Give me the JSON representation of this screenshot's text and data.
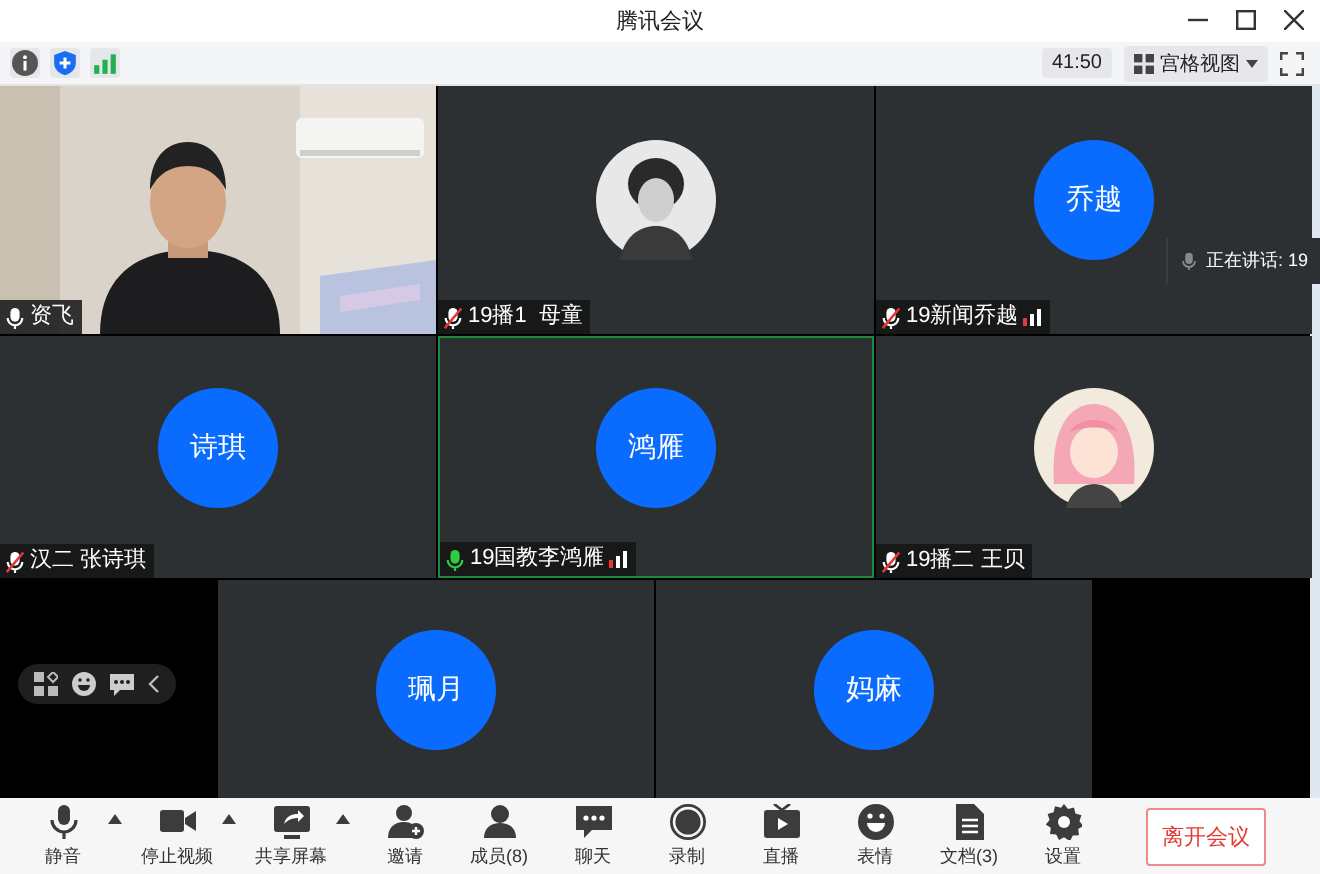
{
  "window": {
    "title": "腾讯会议"
  },
  "info_bar": {
    "timer": "41:50",
    "view": "宫格视图"
  },
  "tiles": [
    {
      "kind": "video",
      "name": "资飞",
      "muted": false,
      "speaking": false,
      "signal": false,
      "active": false
    },
    {
      "name": "19播1  母童",
      "muted": true,
      "speaking": false,
      "signal": false,
      "active": false
    },
    {
      "kind": "initials",
      "avatar_text": "乔越",
      "name": "19新闻乔越",
      "muted": true,
      "speaking": false,
      "signal": true,
      "active": false
    },
    {
      "kind": "initials",
      "avatar_text": "诗琪",
      "name": "汉二 张诗琪",
      "muted": true,
      "speaking": false,
      "signal": false,
      "active": false
    },
    {
      "kind": "initials",
      "avatar_text": "鸿雁",
      "name": "19国教李鸿雁",
      "muted": false,
      "speaking": true,
      "signal": true,
      "active": true
    },
    {
      "name": "19播二 王贝",
      "muted": true,
      "speaking": false,
      "signal": false,
      "active": false
    },
    {
      "kind": "initials",
      "avatar_text": "珮月",
      "active": false
    },
    {
      "kind": "initials",
      "avatar_text": "妈麻",
      "active": false
    }
  ],
  "speaking_hint": "正在讲话: 19",
  "toolbar": [
    {
      "label": "静音",
      "has_menu": true
    },
    {
      "label": "停止视频",
      "has_menu": true
    },
    {
      "label": "共享屏幕",
      "has_menu": true
    },
    {
      "label": "邀请",
      "has_menu": false
    },
    {
      "label": "成员(8)",
      "has_menu": false
    },
    {
      "label": "聊天",
      "has_menu": false
    },
    {
      "label": "录制",
      "has_menu": false
    },
    {
      "label": "直播",
      "has_menu": false
    },
    {
      "label": "表情",
      "has_menu": false
    },
    {
      "label": "文档(3)",
      "has_menu": false
    },
    {
      "label": "设置",
      "has_menu": false
    }
  ],
  "leave_button": "离开会议"
}
